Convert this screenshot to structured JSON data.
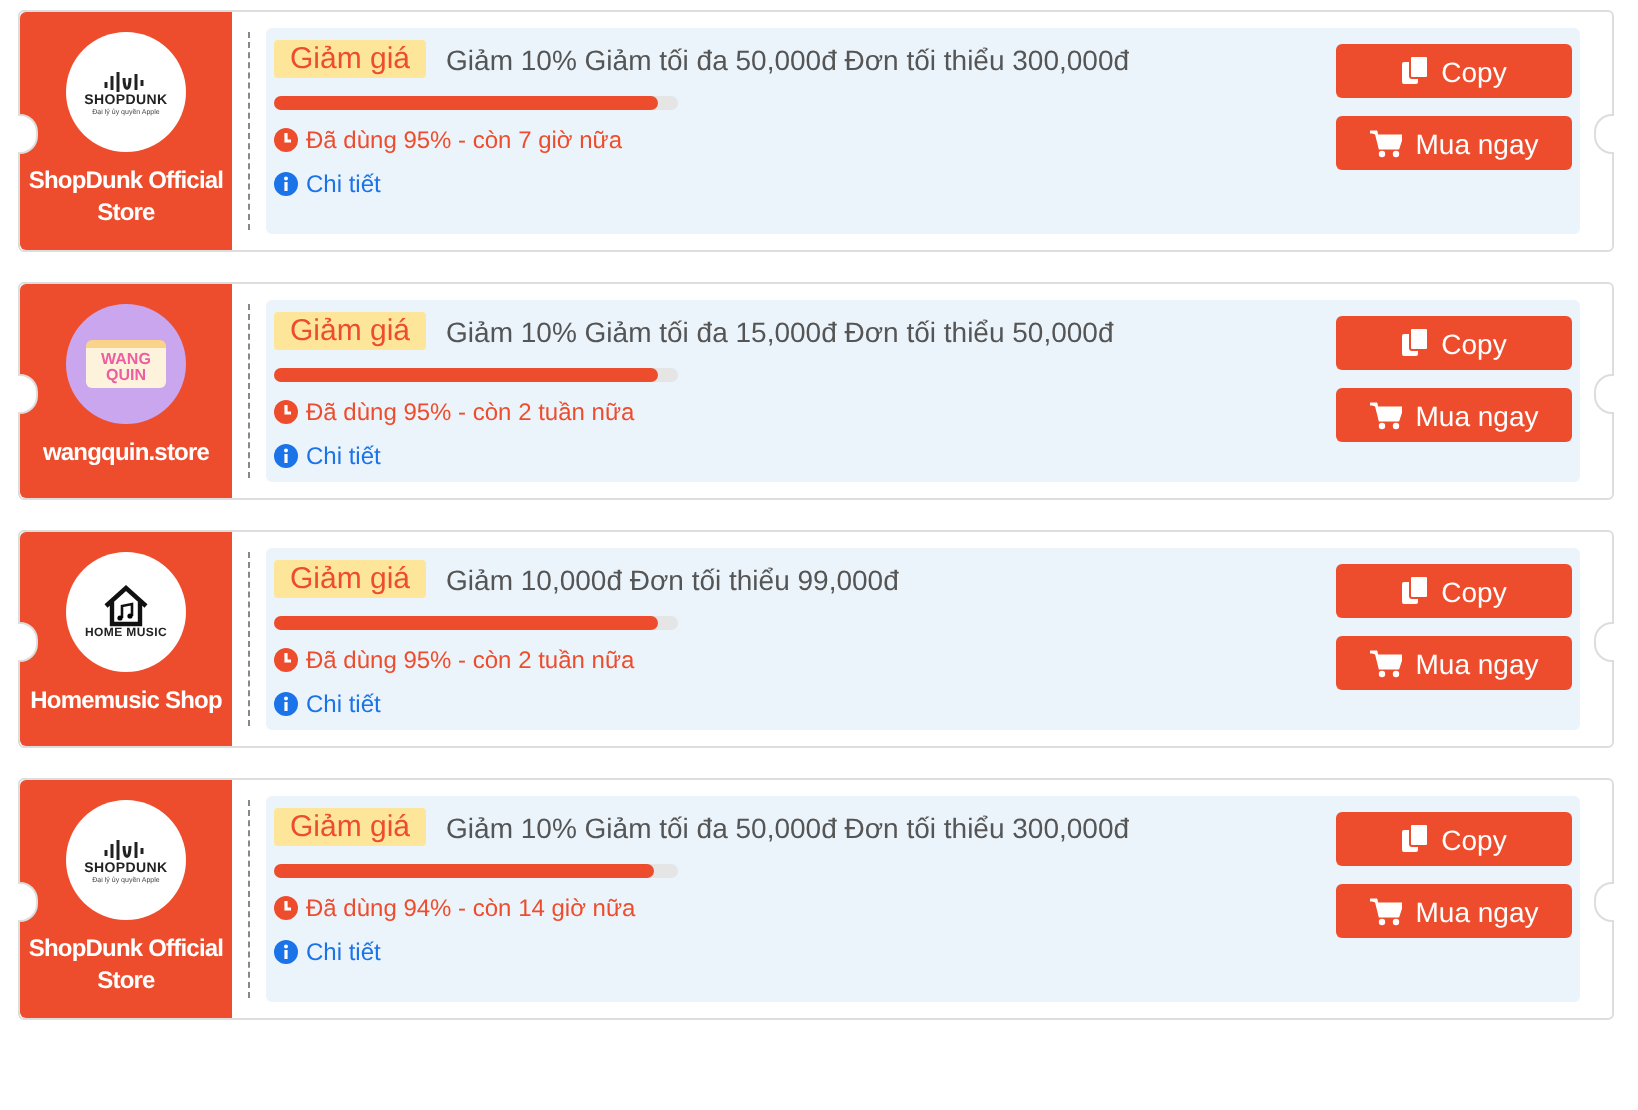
{
  "vouchers": [
    {
      "store": {
        "name": "ShopDunk Official Store",
        "logo": {
          "kind": "shopdunk",
          "text": "SHOPDUNK",
          "tagline": "Đại lý ủy quyền Apple"
        }
      },
      "tag": "Giảm giá",
      "description": "Giảm 10% Giảm tối đa 50,000đ Đơn tối thiểu 300,000đ",
      "level": 0.95,
      "usage": "Đã dùng 95% - còn 7 giờ nữa",
      "details": "Chi tiết",
      "buttons": [
        "Copy",
        "Mua ngay"
      ]
    },
    {
      "store": {
        "name": "wangquin.store",
        "logo": {
          "kind": "wangquin",
          "text": "WANG QUIN"
        }
      },
      "tag": "Giảm giá",
      "description": "Giảm 10% Giảm tối đa 15,000đ Đơn tối thiểu 50,000đ",
      "level": 0.95,
      "usage": "Đã dùng 95% - còn 2 tuần nữa",
      "details": "Chi tiết",
      "buttons": [
        "Copy",
        "Mua ngay"
      ]
    },
    {
      "store": {
        "name": "Homemusic Shop",
        "logo": {
          "kind": "homemusic",
          "text": "HOME MUSIC"
        }
      },
      "tag": "Giảm giá",
      "description": "Giảm 10,000đ Đơn tối thiểu 99,000đ",
      "level": 0.95,
      "usage": "Đã dùng 95% - còn 2 tuần nữa",
      "details": "Chi tiết",
      "buttons": [
        "Copy",
        "Mua ngay"
      ]
    },
    {
      "store": {
        "name": "ShopDunk Official Store",
        "logo": {
          "kind": "shopdunk",
          "text": "SHOPDUNK",
          "tagline": "Đại lý ủy quyền Apple"
        }
      },
      "tag": "Giảm giá",
      "description": "Giảm 10% Giảm tối đa 50,000đ Đơn tối thiểu 300,000đ",
      "level": 0.94,
      "usage": "Đã dùng 94% - còn 14 giờ nữa",
      "details": "Chi tiết",
      "buttons": [
        "Copy",
        "Mua ngay"
      ]
    }
  ]
}
